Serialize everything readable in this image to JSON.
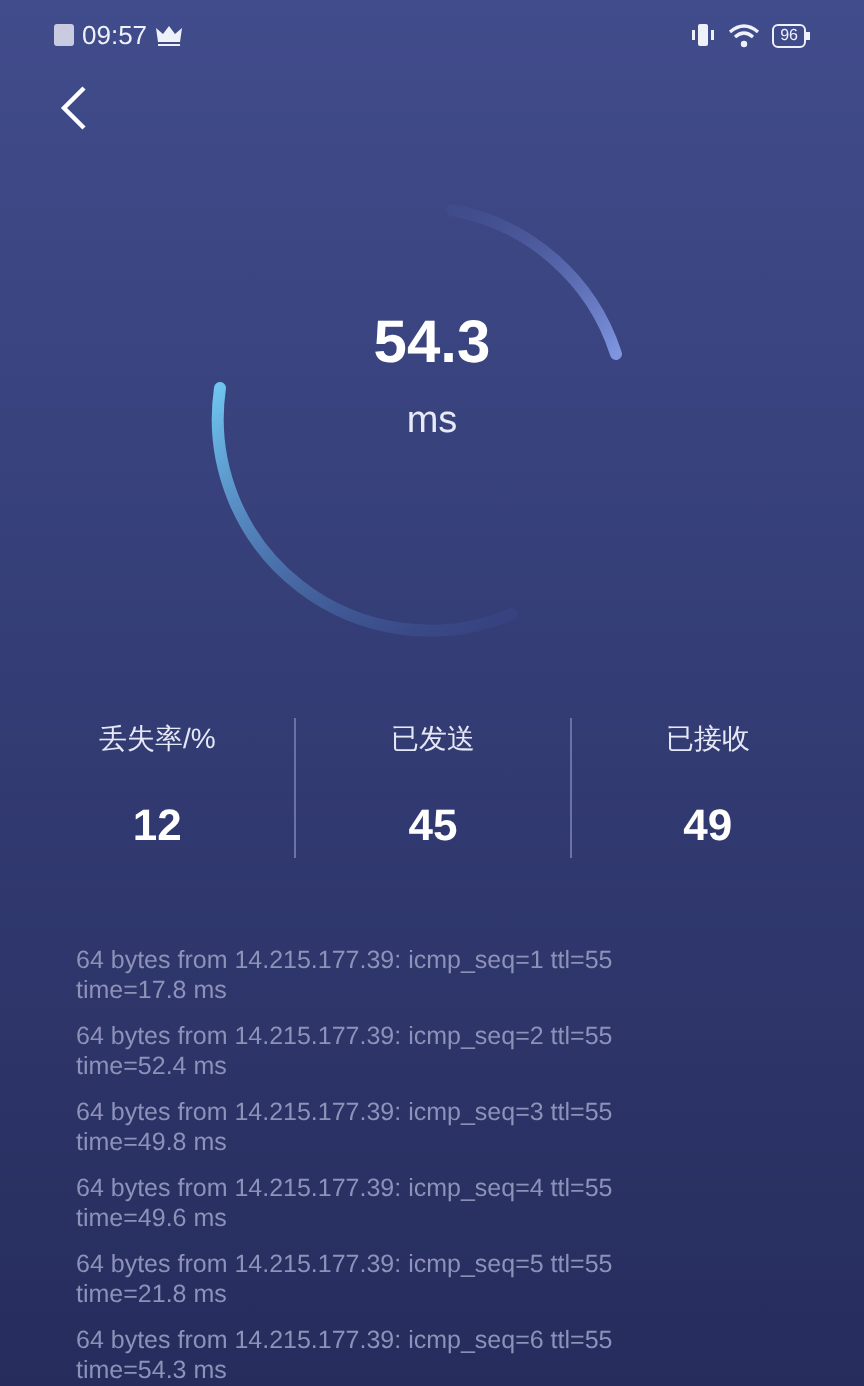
{
  "status_bar": {
    "time": "09:57",
    "battery": "96"
  },
  "gauge": {
    "value": "54.3",
    "unit": "ms"
  },
  "stats": [
    {
      "label": "丢失率/%",
      "value": "12"
    },
    {
      "label": "已发送",
      "value": "45"
    },
    {
      "label": "已接收",
      "value": "49"
    }
  ],
  "log": [
    {
      "line": "64 bytes from 14.215.177.39: icmp_seq=1 ttl=55",
      "time": "time=17.8 ms"
    },
    {
      "line": "64 bytes from 14.215.177.39: icmp_seq=2 ttl=55",
      "time": "time=52.4 ms"
    },
    {
      "line": "64 bytes from 14.215.177.39: icmp_seq=3 ttl=55",
      "time": "time=49.8 ms"
    },
    {
      "line": "64 bytes from 14.215.177.39: icmp_seq=4 ttl=55",
      "time": "time=49.6 ms"
    },
    {
      "line": "64 bytes from 14.215.177.39: icmp_seq=5 ttl=55",
      "time": "time=21.8 ms"
    },
    {
      "line": "64 bytes from 14.215.177.39: icmp_seq=6 ttl=55",
      "time": "time=54.3 ms"
    }
  ]
}
